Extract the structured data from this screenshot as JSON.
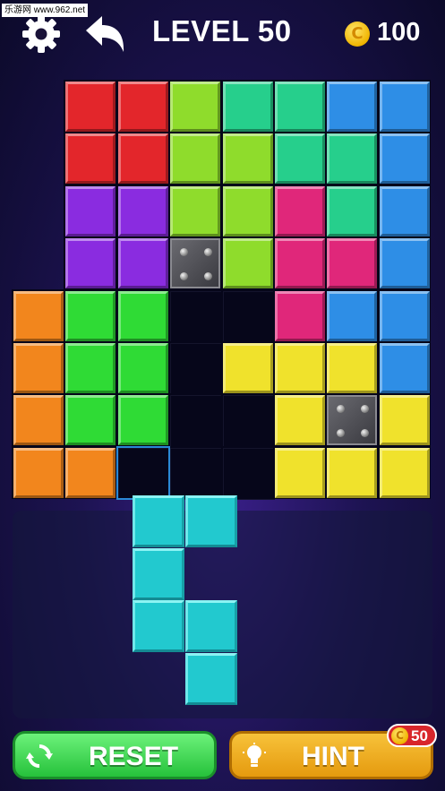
{
  "watermark": "乐游网 www.962.net",
  "header": {
    "settings_icon": "gear-icon",
    "back_icon": "back-arrow-icon",
    "level_label": "LEVEL 50",
    "coin_symbol": "C",
    "coins": "100"
  },
  "board": {
    "colors": {
      "R": "#e3262b",
      "G": "#8fdc2c",
      "T": "#26cf8c",
      "B": "#2e8ee6",
      "P": "#8a2ce0",
      "M": "#e0277a",
      "O": "#f2861d",
      "L": "#2fdb35",
      "Y": "#f0e22c"
    },
    "rows": [
      "-RRGTTBB",
      "-RRGGTTB",
      "-PPGGMTB",
      "-PPXGMMB",
      "OLL..MBB",
      "OLL.YYYB",
      "OLL..YXY",
      "OO...YYY"
    ]
  },
  "piece": {
    "color": "#22c9cf",
    "cells": [
      [
        0,
        0
      ],
      [
        1,
        0
      ],
      [
        0,
        1
      ],
      [
        0,
        2
      ],
      [
        1,
        2
      ],
      [
        1,
        3
      ]
    ]
  },
  "buttons": {
    "reset_label": "RESET",
    "hint_label": "HINT",
    "hint_cost": "50",
    "reset_icon": "refresh-icon",
    "hint_icon": "light-bulb-icon"
  }
}
